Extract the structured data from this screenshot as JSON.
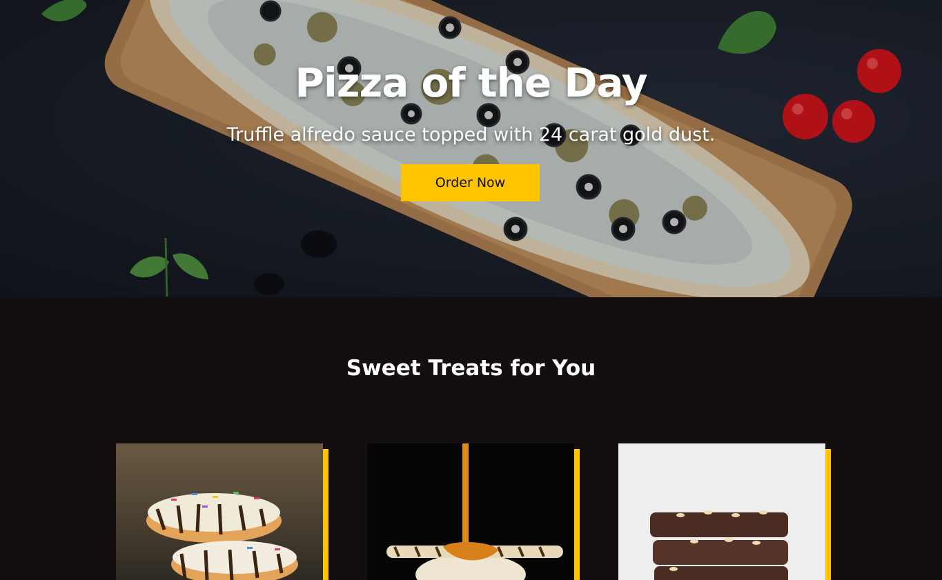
{
  "hero": {
    "title": "Pizza of the Day",
    "subtitle": "Truffle alfredo sauce topped with 24 carat gold dust.",
    "cta_label": "Order Now"
  },
  "treats": {
    "heading": "Sweet Treats for You",
    "items": [
      {
        "image": "donuts-photo"
      },
      {
        "image": "ice-cream-caramel-photo"
      },
      {
        "image": "brownies-photo"
      }
    ]
  },
  "colors": {
    "accent": "#ffc400",
    "section_bg": "#140e0e",
    "hero_bg": "#1a1f29"
  }
}
